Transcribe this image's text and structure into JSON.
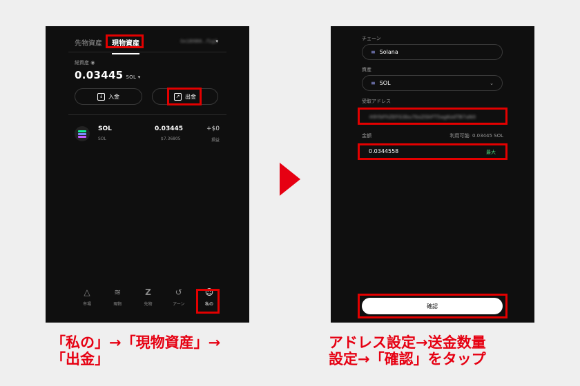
{
  "left": {
    "tab_futures": "先物資産",
    "tab_spot": "現物資産",
    "wallet_address": "0x1B9B8...f1g2",
    "total_label": "総資産",
    "total_value": "0.03445",
    "total_unit": "SOL ▾",
    "deposit_label": "入金",
    "withdraw_label": "出金",
    "asset": {
      "name": "SOL",
      "sub": "SOL",
      "amount": "0.03445",
      "usd": "$7.36805",
      "pnl": "+$0",
      "pnl_label": "損益"
    },
    "nav": [
      "市場",
      "現物",
      "先物",
      "アーン",
      "私の"
    ]
  },
  "right": {
    "chain_label": "チェーン",
    "chain_value": "Solana",
    "asset_label": "資産",
    "asset_value": "SOL",
    "address_label": "受取アドレス",
    "address_value": "H9YbFhZEFG3bu7bsZGkFT5agKodTB7aNX",
    "amount_label": "金額",
    "available_label": "利用可能: 0.03445 SOL",
    "amount_value": "0.0344558",
    "max_label": "最大",
    "confirm_label": "確認"
  },
  "captions": {
    "left_line1": "「私の」→「現物資産」→",
    "left_line2": "「出金」",
    "right_line1": "アドレス設定→送金数量",
    "right_line2": "設定→「確認」をタップ"
  },
  "colors": {
    "highlight": "#e30000",
    "accent_red": "#e60012",
    "max_green": "#4cd37a"
  }
}
